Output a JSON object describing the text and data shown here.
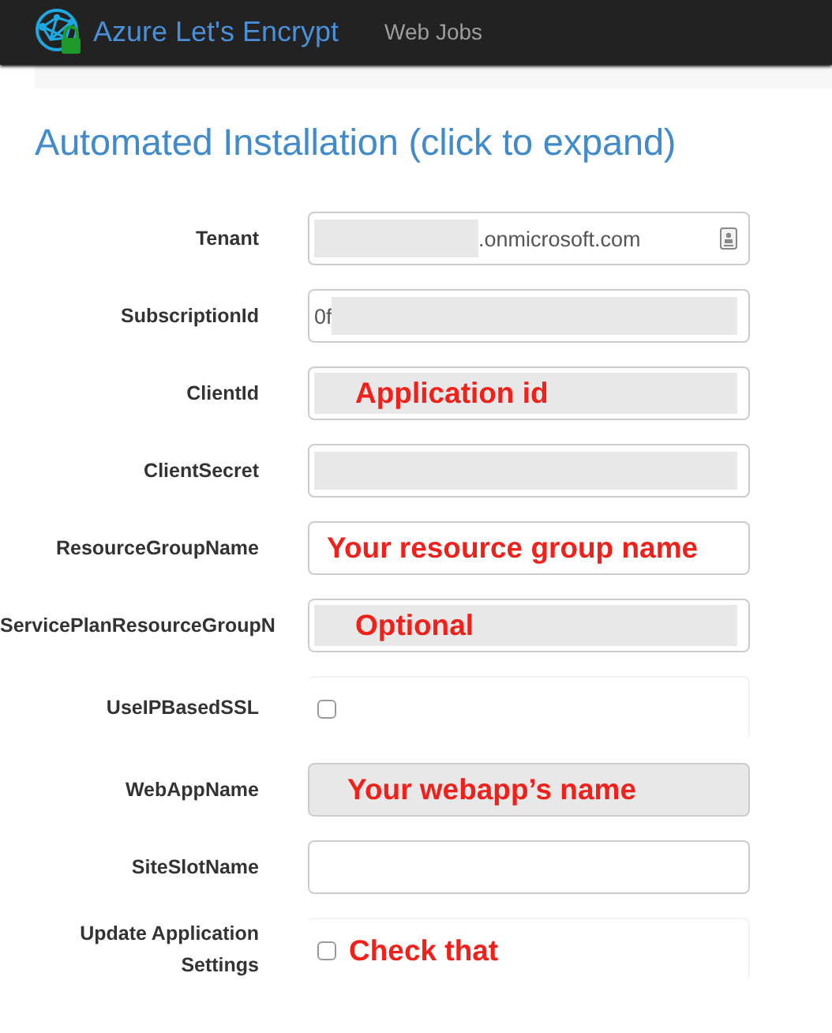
{
  "navbar": {
    "brand": "Azure Let's Encrypt",
    "links": [
      {
        "label": "Web Jobs",
        "selected": false
      }
    ]
  },
  "heading": "Automated Installation (click to expand)",
  "fields": [
    {
      "label": "Tenant",
      "kind": "text",
      "shaded": false,
      "autofill_icon": true,
      "segments": [
        {
          "kind": "redacted",
          "wide": false
        },
        {
          "kind": "text",
          "text": ".onmicrosoft.com"
        }
      ]
    },
    {
      "label": "SubscriptionId",
      "kind": "text",
      "shaded": false,
      "segments": [
        {
          "kind": "text",
          "text": "0f"
        },
        {
          "kind": "redacted",
          "wide": true
        }
      ]
    },
    {
      "label": "ClientId",
      "kind": "text",
      "shaded": false,
      "segments": [
        {
          "kind": "redacted",
          "wide": true,
          "annotation": "Application id"
        }
      ]
    },
    {
      "label": "ClientSecret",
      "kind": "text",
      "shaded": false,
      "segments": [
        {
          "kind": "redacted",
          "wide": true
        }
      ]
    },
    {
      "label": "ResourceGroupName",
      "kind": "text",
      "shaded": false,
      "segments": [
        {
          "kind": "annotation",
          "text": "Your resource group name"
        }
      ]
    },
    {
      "label": "ServicePlanResourceGroupN",
      "kind": "text",
      "shaded": false,
      "segments": [
        {
          "kind": "redacted",
          "wide": true,
          "annotation": "Optional"
        }
      ]
    },
    {
      "label": "UseIPBasedSSL",
      "kind": "checkbox",
      "checked": false
    },
    {
      "label": "WebAppName",
      "kind": "text",
      "shaded": true,
      "segments": [
        {
          "kind": "annotation",
          "text": "Your webapp’s name"
        }
      ]
    },
    {
      "label": "SiteSlotName",
      "kind": "text",
      "shaded": false
    },
    {
      "label": "Update Application Settings",
      "kind": "checkbox",
      "checked": false,
      "segments": [
        {
          "kind": "annotation",
          "text": "Check that"
        }
      ]
    }
  ]
}
